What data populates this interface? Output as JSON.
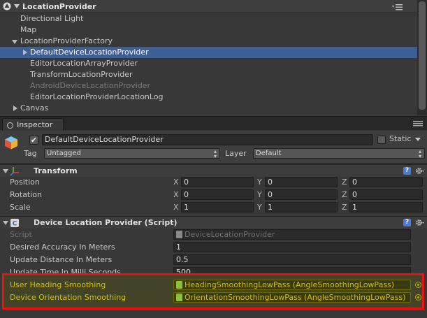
{
  "hierarchy": {
    "scene_name": "LocationProvider",
    "items": [
      {
        "label": "Directional Light"
      },
      {
        "label": "Map"
      },
      {
        "label": "LocationProviderFactory"
      },
      {
        "label": "DefaultDeviceLocationProvider"
      },
      {
        "label": "EditorLocationArrayProvider"
      },
      {
        "label": "TransformLocationProvider"
      },
      {
        "label": "AndroidDeviceLocationProvider"
      },
      {
        "label": "EditorLocationProviderLocationLog"
      },
      {
        "label": "Canvas"
      }
    ]
  },
  "inspector": {
    "tab_label": "Inspector",
    "object_name": "DefaultDeviceLocationProvider",
    "static_label": "Static",
    "tag_label": "Tag",
    "tag_value": "Untagged",
    "layer_label": "Layer",
    "layer_value": "Default"
  },
  "transform": {
    "title": "Transform",
    "axis": {
      "x": "X",
      "y": "Y",
      "z": "Z"
    },
    "rows": [
      {
        "label": "Position",
        "x": "0",
        "y": "0",
        "z": "0"
      },
      {
        "label": "Rotation",
        "x": "0",
        "y": "0",
        "z": "0"
      },
      {
        "label": "Scale",
        "x": "1",
        "y": "1",
        "z": "1"
      }
    ]
  },
  "device_location_provider": {
    "title": "Device Location Provider (Script)",
    "script_label": "Script",
    "script_value": "DeviceLocationProvider",
    "desired_accuracy_label": "Desired Accuracy In Meters",
    "desired_accuracy_value": "1",
    "update_distance_label": "Update Distance In Meters",
    "update_distance_value": "0.5",
    "update_time_label": "Update Time In Milli Seconds",
    "update_time_value": "500",
    "heading_smoothing_label": "User Heading Smoothing",
    "heading_smoothing_value": "HeadingSmoothingLowPass (AngleSmoothingLowPass)",
    "orientation_smoothing_label": "Device Orientation Smoothing",
    "orientation_smoothing_value": "OrientationSmoothingLowPass (AngleSmoothingLowPass)"
  },
  "colors": {
    "selection": "#3e5f96",
    "highlight_border": "#ee1111",
    "modified_text": "#d4c000"
  }
}
